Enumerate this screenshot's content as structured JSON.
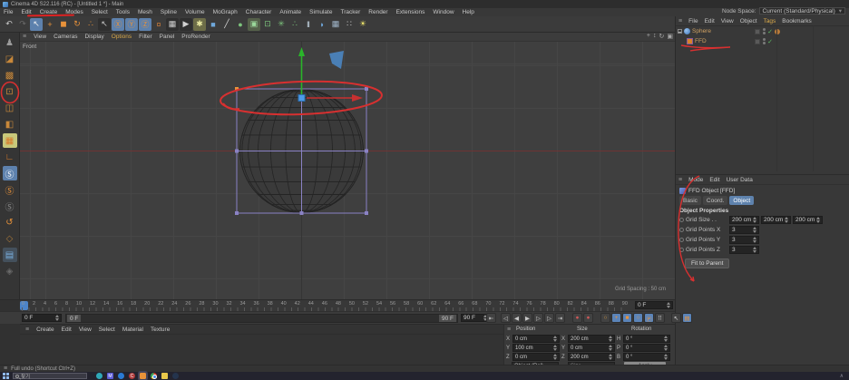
{
  "title_bar": {
    "title": "Cinema 4D S22.116 (RC) - [Untitled 1 *] - Main"
  },
  "menu_bar": {
    "items": [
      "File",
      "Edit",
      "Create",
      "Modes",
      "Select",
      "Tools",
      "Mesh",
      "Spline",
      "Volume",
      "MoGraph",
      "Character",
      "Animate",
      "Simulate",
      "Tracker",
      "Render",
      "Extensions",
      "Window",
      "Help"
    ],
    "node_space_label": "Node Space:",
    "node_space_value": "Current (Standard/Physical)"
  },
  "toolbar": {
    "icons": [
      {
        "name": "undo-icon",
        "glyph": "↶",
        "color": "#c8c8c8"
      },
      {
        "name": "redo-icon",
        "glyph": "↷",
        "color": "#6a6a6a"
      },
      {
        "name": "live-selection-icon",
        "glyph": "↖",
        "color": "#f0f0f0",
        "bg": "#5d81ad"
      },
      {
        "name": "move-tool-icon",
        "glyph": "+",
        "color": "#e8923a"
      },
      {
        "name": "scale-tool-icon",
        "glyph": "◼",
        "color": "#e8923a"
      },
      {
        "name": "rotate-tool-icon",
        "glyph": "↻",
        "color": "#e8923a"
      },
      {
        "name": "scale-dots-icon",
        "glyph": "∴",
        "color": "#e8923a"
      },
      {
        "name": "last-tool-icon",
        "glyph": "↖",
        "color": "#c8c8c8",
        "bg": "#2f2f2f"
      },
      {
        "name": "x-axis-lock-icon",
        "glyph": "Ⓧ",
        "color": "#e8923a",
        "bg": "#5d81ad"
      },
      {
        "name": "y-axis-lock-icon",
        "glyph": "Ⓨ",
        "color": "#e8923a",
        "bg": "#5d81ad"
      },
      {
        "name": "z-axis-lock-icon",
        "glyph": "Ⓩ",
        "color": "#e8923a",
        "bg": "#5d81ad"
      },
      {
        "name": "coord-system-icon",
        "glyph": "¤",
        "color": "#c87a3a"
      },
      {
        "name": "render-view-icon",
        "glyph": "▦",
        "color": "#d0d0d0",
        "bg": "#2f2f2f"
      },
      {
        "name": "render-queue-icon",
        "glyph": "▶",
        "color": "#d0d0d0",
        "bg": "#2f2f2f"
      },
      {
        "name": "render-settings-icon",
        "glyph": "✱",
        "color": "#e8e8a0",
        "bg": "#6d6d48"
      },
      {
        "name": "primitive-cube-icon",
        "glyph": "■",
        "color": "#6fa8dc"
      },
      {
        "name": "spline-pen-icon",
        "glyph": "╱",
        "color": "#d8d8d8"
      },
      {
        "name": "generators-icon",
        "glyph": "●",
        "color": "#7cc47c"
      },
      {
        "name": "deformers-icon",
        "glyph": "▣",
        "color": "#9ad89a",
        "bg": "#55604a"
      },
      {
        "name": "volume-icon",
        "glyph": "⊡",
        "color": "#7cc47c"
      },
      {
        "name": "mograph-icon",
        "glyph": "✳",
        "color": "#7cc47c"
      },
      {
        "name": "clones-icon",
        "glyph": "∴",
        "color": "#7cc47c"
      },
      {
        "name": "symmetry-icon",
        "glyph": "‖",
        "color": "#cfe2f0"
      },
      {
        "name": "camera-icon",
        "glyph": "◗",
        "color": "#6fa8dc"
      },
      {
        "name": "array-grid-icon",
        "glyph": "▦",
        "color": "#9fb4c8"
      },
      {
        "name": "sky-icon",
        "glyph": "∷",
        "color": "#cfcfcf"
      },
      {
        "name": "light-icon",
        "glyph": "☀",
        "color": "#e8e06a"
      }
    ]
  },
  "sidebar": {
    "icons": [
      {
        "name": "make-editable-icon",
        "glyph": "♟",
        "color": "#9a9a9a"
      },
      {
        "name": "model-mode-icon",
        "glyph": "◪",
        "color": "#c8883a"
      },
      {
        "name": "texture-mode-icon",
        "glyph": "▩",
        "color": "#c8883a"
      },
      {
        "name": "points-mode-icon",
        "glyph": "⊡",
        "color": "#c8883a"
      },
      {
        "name": "edges-mode-icon",
        "glyph": "◫",
        "color": "#c8883a"
      },
      {
        "name": "polygons-mode-icon",
        "glyph": "◧",
        "color": "#c8883a"
      },
      {
        "name": "enable-axis-icon",
        "glyph": "▦",
        "color": "#d87a2a",
        "bg": "#c8c87a"
      },
      {
        "name": "workplane-icon",
        "glyph": "∟",
        "color": "#d87a2a"
      },
      {
        "name": "snap-icon",
        "glyph": "Ⓢ",
        "color": "#fff",
        "bg": "#5d81ad"
      },
      {
        "name": "quantize-icon",
        "glyph": "Ⓢ",
        "color": "#e8923a"
      },
      {
        "name": "snap-off-icon",
        "glyph": "Ⓢ",
        "color": "#888"
      },
      {
        "name": "magnet-icon",
        "glyph": "↺",
        "color": "#e8923a"
      },
      {
        "name": "mesh-check-icon",
        "glyph": "◇",
        "color": "#a8783a"
      },
      {
        "name": "layers-icon",
        "glyph": "▤",
        "color": "#7ab0e0",
        "bg": "#44505c"
      },
      {
        "name": "modeling-settings-icon",
        "glyph": "◈",
        "color": "#6a6a6a"
      }
    ]
  },
  "viewport": {
    "menu": [
      "View",
      "Cameras",
      "Display",
      {
        "label": "Options",
        "hl": true
      },
      "Filter",
      "Panel",
      "ProRender"
    ],
    "controls": [
      {
        "name": "pan-view-icon",
        "glyph": "+"
      },
      {
        "name": "zoom-view-icon",
        "glyph": "↕"
      },
      {
        "name": "rotate-view-icon",
        "glyph": "↻"
      },
      {
        "name": "toggle-view-icon",
        "glyph": "▣"
      }
    ],
    "view_label": "Front",
    "grid_spacing": "Grid Spacing : 50 cm"
  },
  "object_manager": {
    "menu": [
      "File",
      "Edit",
      "View",
      "Object",
      {
        "label": "Tags",
        "hl": true
      },
      "Bookmarks"
    ],
    "objects": [
      {
        "name": "Sphere"
      },
      {
        "name": "FFD"
      }
    ]
  },
  "attribute_manager": {
    "menu": [
      "Mode",
      "Edit",
      "User Data"
    ],
    "title": "FFD Object [FFD]",
    "tabs": [
      "Basic",
      "Coord.",
      "Object"
    ],
    "section": "Object Properties",
    "rows": [
      {
        "label": "Grid Size . .",
        "v1": "200 cm",
        "v2": "200 cm",
        "v3": "200 cm"
      },
      {
        "label": "Grid Points X",
        "v1": "3"
      },
      {
        "label": "Grid Points Y",
        "v1": "3"
      },
      {
        "label": "Grid Points Z",
        "v1": "3"
      }
    ],
    "fit_button": "Fit to Parent"
  },
  "timeline": {
    "ticks": [
      0,
      2,
      4,
      6,
      8,
      10,
      12,
      14,
      16,
      18,
      20,
      22,
      24,
      26,
      28,
      30,
      32,
      34,
      36,
      38,
      40,
      42,
      44,
      46,
      48,
      50,
      52,
      54,
      56,
      58,
      60,
      62,
      64,
      66,
      68,
      70,
      72,
      74,
      76,
      78,
      80,
      82,
      84,
      86,
      88,
      90
    ],
    "end_field": "0 F",
    "current_field": "0 F",
    "range_start_chip": "0 F",
    "range_end_chip": "90 F",
    "range_end_field": "90 F"
  },
  "transport": {
    "buttons": [
      {
        "name": "goto-start-button",
        "glyph": "⇤"
      },
      {
        "name": "prev-key-button",
        "glyph": "◁",
        "sp": 4
      },
      {
        "name": "prev-frame-button",
        "glyph": "◀"
      },
      {
        "name": "play-button",
        "glyph": "▶"
      },
      {
        "name": "next-frame-button",
        "glyph": "▷"
      },
      {
        "name": "next-key-button",
        "glyph": "▷"
      },
      {
        "name": "goto-end-button",
        "glyph": "⇥"
      },
      {
        "name": "record-keyframe-button",
        "glyph": "●",
        "color": "#d05858",
        "sp": 7
      },
      {
        "name": "autokey-button",
        "glyph": "●",
        "color": "#d05858"
      },
      {
        "name": "keyframe-selection-button",
        "glyph": "○",
        "color": "#e8a33d",
        "sp": 7
      },
      {
        "name": "key-position-button",
        "glyph": "+",
        "color": "#e8923a",
        "bg": "#5b84b8"
      },
      {
        "name": "key-scale-button",
        "glyph": "■",
        "color": "#e8923a",
        "bg": "#5b84b8"
      },
      {
        "name": "key-rotation-button",
        "glyph": "○",
        "color": "#e8923a",
        "bg": "#5b84b8"
      },
      {
        "name": "key-parameter-button",
        "glyph": "Ⓟ",
        "color": "#e8923a",
        "bg": "#5b84b8"
      },
      {
        "name": "key-pla-button",
        "glyph": "⠿",
        "color": "#b8b8b8"
      },
      {
        "name": "solo-button",
        "glyph": "↖",
        "color": "#d8d8d8",
        "sp": 6
      },
      {
        "name": "render-bars-button",
        "glyph": "▤",
        "color": "#e8923a",
        "bg": "#5b84b8"
      }
    ]
  },
  "material_manager": {
    "menu": [
      "Create",
      "Edit",
      "View",
      "Select",
      "Material",
      "Texture"
    ]
  },
  "coordinates": {
    "headers": {
      "position": "Position",
      "size": "Size",
      "rotation": "Rotation"
    },
    "rows": [
      {
        "l1": "X",
        "v1": "0 cm",
        "l2": "X",
        "v2": "200 cm",
        "l3": "H",
        "v3": "0 °"
      },
      {
        "l1": "Y",
        "v1": "100 cm",
        "l2": "Y",
        "v2": "0 cm",
        "l3": "P",
        "v3": "0 °"
      },
      {
        "l1": "Z",
        "v1": "0 cm",
        "l2": "Z",
        "v2": "200 cm",
        "l3": "B",
        "v3": "0 °"
      }
    ],
    "mode_dropdown": "Object (Rel)",
    "size_dropdown": "Size",
    "apply_button": "Apply"
  },
  "status_bar": {
    "text": "Full undo (Shortcut Ctrl+Z)"
  },
  "taskbar": {
    "search_text": "찾기",
    "apps": [
      {
        "name": "taskbar-app-edge-icon",
        "bg": "#2fa8b8"
      },
      {
        "name": "taskbar-app-office-icon",
        "bg": "#5b5bd6",
        "letter": "M",
        "sq": true
      },
      {
        "name": "taskbar-app-blue-icon",
        "bg": "#2a7ad4"
      },
      {
        "name": "taskbar-app-c-icon",
        "bg": "#b03a3a",
        "letter": "C"
      },
      {
        "name": "taskbar-app-cinema4d-icon",
        "bg": "#e8923a",
        "sq": true,
        "active": true
      },
      {
        "name": "taskbar-app-chrome-icon",
        "chrome": true
      },
      {
        "name": "taskbar-app-explorer-icon",
        "bg": "#e8c84a",
        "sq": true
      },
      {
        "name": "taskbar-app-dark-icon",
        "bg": "#24344d"
      }
    ]
  }
}
